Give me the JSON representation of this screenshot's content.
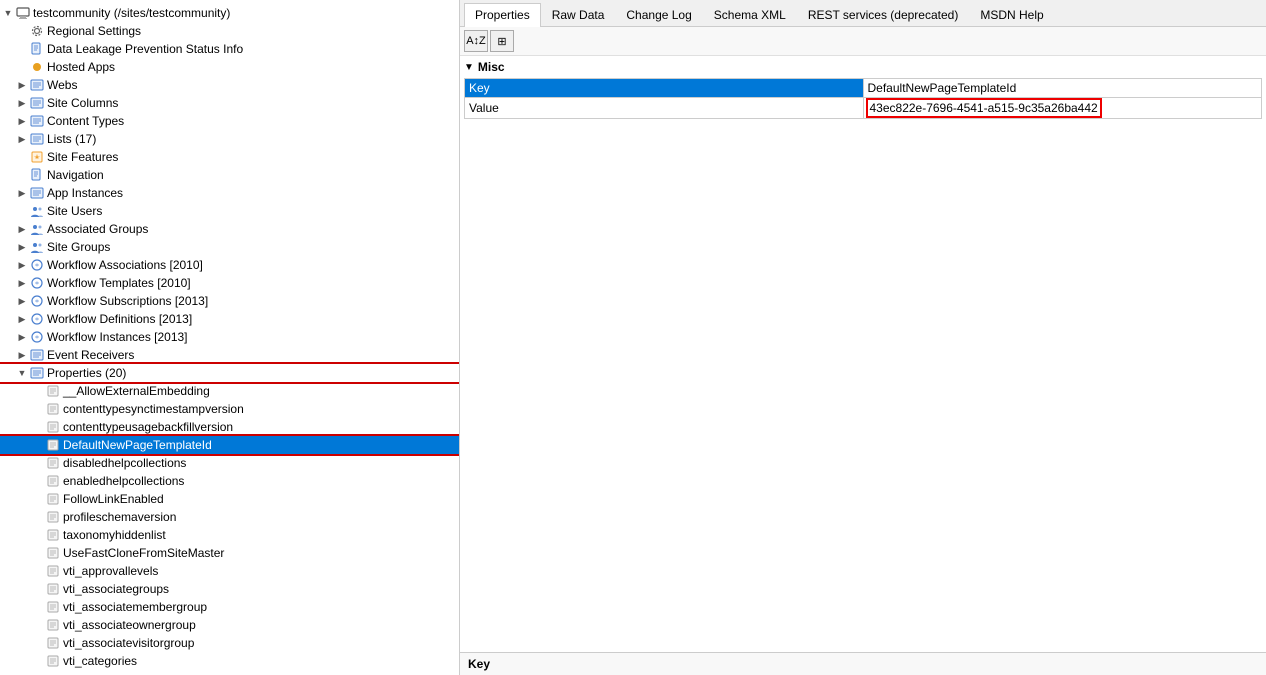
{
  "tabs": [
    {
      "id": "properties",
      "label": "Properties",
      "active": true
    },
    {
      "id": "raw-data",
      "label": "Raw Data",
      "active": false
    },
    {
      "id": "change-log",
      "label": "Change Log",
      "active": false
    },
    {
      "id": "schema-xml",
      "label": "Schema XML",
      "active": false
    },
    {
      "id": "rest-services",
      "label": "REST services (deprecated)",
      "active": false
    },
    {
      "id": "msdn-help",
      "label": "MSDN Help",
      "active": false
    }
  ],
  "toolbar": {
    "sort_az": "A↕Z",
    "grid_icon": "⊞"
  },
  "properties_section": {
    "label": "Misc",
    "rows": [
      {
        "label": "Key",
        "value": "DefaultNewPageTemplateId",
        "is_key": true
      },
      {
        "label": "Value",
        "value": "43ec822e-7696-4541-a515-9c35a26ba442",
        "is_value": true
      }
    ]
  },
  "status_bar": {
    "label": "Key"
  },
  "tree": {
    "items": [
      {
        "id": "testcommunity",
        "level": 0,
        "label": "testcommunity (/sites/testcommunity)",
        "expanded": true,
        "icon": "computer",
        "hasExpand": true
      },
      {
        "id": "regional-settings",
        "level": 1,
        "label": "Regional Settings",
        "expanded": false,
        "icon": "gear",
        "hasExpand": false
      },
      {
        "id": "dlp",
        "level": 1,
        "label": "Data Leakage Prevention Status Info",
        "expanded": false,
        "icon": "page",
        "hasExpand": false
      },
      {
        "id": "hosted-apps",
        "level": 1,
        "label": "Hosted Apps",
        "expanded": false,
        "icon": "dot-orange",
        "hasExpand": false
      },
      {
        "id": "webs",
        "level": 1,
        "label": "Webs",
        "expanded": false,
        "icon": "list",
        "hasExpand": true
      },
      {
        "id": "site-columns",
        "level": 1,
        "label": "Site Columns",
        "expanded": false,
        "icon": "list",
        "hasExpand": true
      },
      {
        "id": "content-types",
        "level": 1,
        "label": "Content Types",
        "expanded": false,
        "icon": "list",
        "hasExpand": true
      },
      {
        "id": "lists",
        "level": 1,
        "label": "Lists (17)",
        "expanded": false,
        "icon": "list",
        "hasExpand": true
      },
      {
        "id": "site-features",
        "level": 1,
        "label": "Site Features",
        "expanded": false,
        "icon": "feature",
        "hasExpand": false
      },
      {
        "id": "navigation",
        "level": 1,
        "label": "Navigation",
        "expanded": false,
        "icon": "page",
        "hasExpand": false
      },
      {
        "id": "app-instances",
        "level": 1,
        "label": "App Instances",
        "expanded": false,
        "icon": "list",
        "hasExpand": true
      },
      {
        "id": "site-users",
        "level": 1,
        "label": "Site Users",
        "expanded": false,
        "icon": "people",
        "hasExpand": false
      },
      {
        "id": "associated-groups",
        "level": 1,
        "label": "Associated Groups",
        "expanded": false,
        "icon": "people",
        "hasExpand": true
      },
      {
        "id": "site-groups",
        "level": 1,
        "label": "Site Groups",
        "expanded": false,
        "icon": "people",
        "hasExpand": true
      },
      {
        "id": "workflow-associations",
        "level": 1,
        "label": "Workflow Associations [2010]",
        "expanded": false,
        "icon": "workflow",
        "hasExpand": true
      },
      {
        "id": "workflow-templates",
        "level": 1,
        "label": "Workflow Templates [2010]",
        "expanded": false,
        "icon": "workflow",
        "hasExpand": true
      },
      {
        "id": "workflow-subscriptions",
        "level": 1,
        "label": "Workflow Subscriptions [2013]",
        "expanded": false,
        "icon": "workflow",
        "hasExpand": true
      },
      {
        "id": "workflow-definitions",
        "level": 1,
        "label": "Workflow Definitions [2013]",
        "expanded": false,
        "icon": "workflow",
        "hasExpand": true
      },
      {
        "id": "workflow-instances",
        "level": 1,
        "label": "Workflow Instances [2013]",
        "expanded": false,
        "icon": "workflow",
        "hasExpand": true
      },
      {
        "id": "event-receivers",
        "level": 1,
        "label": "Event Receivers",
        "expanded": false,
        "icon": "list",
        "hasExpand": true
      },
      {
        "id": "properties",
        "level": 1,
        "label": "Properties (20)",
        "expanded": true,
        "icon": "list",
        "hasExpand": true,
        "redbox": true
      },
      {
        "id": "AllowExternalEmbedding",
        "level": 2,
        "label": "__AllowExternalEmbedding",
        "expanded": false,
        "icon": "prop",
        "hasExpand": false
      },
      {
        "id": "contenttypesynctimestampversion",
        "level": 2,
        "label": "contenttypesynctimestampversion",
        "expanded": false,
        "icon": "prop",
        "hasExpand": false
      },
      {
        "id": "contenttypeusagebackfillversion",
        "level": 2,
        "label": "contenttypeusagebackfillversion",
        "expanded": false,
        "icon": "prop",
        "hasExpand": false
      },
      {
        "id": "DefaultNewPageTemplateId",
        "level": 2,
        "label": "DefaultNewPageTemplateId",
        "expanded": false,
        "icon": "prop",
        "hasExpand": false,
        "selected": true,
        "redbox": true
      },
      {
        "id": "disabledhelpcollections",
        "level": 2,
        "label": "disabledhelpcollections",
        "expanded": false,
        "icon": "prop",
        "hasExpand": false
      },
      {
        "id": "enabledhelpcollections",
        "level": 2,
        "label": "enabledhelpcollections",
        "expanded": false,
        "icon": "prop",
        "hasExpand": false
      },
      {
        "id": "FollowLinkEnabled",
        "level": 2,
        "label": "FollowLinkEnabled",
        "expanded": false,
        "icon": "prop",
        "hasExpand": false
      },
      {
        "id": "profileschemaversion",
        "level": 2,
        "label": "profileschemaversion",
        "expanded": false,
        "icon": "prop",
        "hasExpand": false
      },
      {
        "id": "taxonomyhiddenlist",
        "level": 2,
        "label": "taxonomyhiddenlist",
        "expanded": false,
        "icon": "prop",
        "hasExpand": false
      },
      {
        "id": "UseFastCloneFromSiteMaster",
        "level": 2,
        "label": "UseFastCloneFromSiteMaster",
        "expanded": false,
        "icon": "prop",
        "hasExpand": false
      },
      {
        "id": "vti_approvallevels",
        "level": 2,
        "label": "vti_approvallevels",
        "expanded": false,
        "icon": "prop",
        "hasExpand": false
      },
      {
        "id": "vti_associategroups",
        "level": 2,
        "label": "vti_associategroups",
        "expanded": false,
        "icon": "prop",
        "hasExpand": false
      },
      {
        "id": "vti_associatemembergroup",
        "level": 2,
        "label": "vti_associatemembergroup",
        "expanded": false,
        "icon": "prop",
        "hasExpand": false
      },
      {
        "id": "vti_associateownergroup",
        "level": 2,
        "label": "vti_associateownergroup",
        "expanded": false,
        "icon": "prop",
        "hasExpand": false
      },
      {
        "id": "vti_associatevisitorgroup",
        "level": 2,
        "label": "vti_associatevisitorgroup",
        "expanded": false,
        "icon": "prop",
        "hasExpand": false
      },
      {
        "id": "vti_categories",
        "level": 2,
        "label": "vti_categories",
        "expanded": false,
        "icon": "prop",
        "hasExpand": false
      }
    ]
  }
}
